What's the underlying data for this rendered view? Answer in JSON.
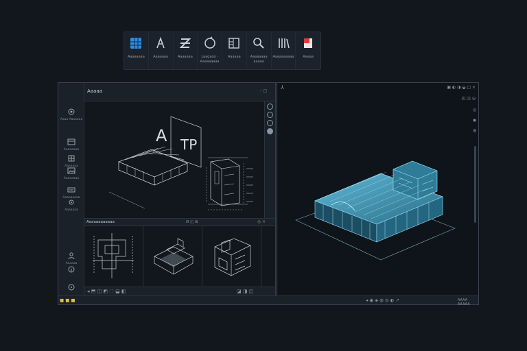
{
  "ribbon": {
    "buttons": [
      {
        "icon": "grid-icon",
        "label": "Aaaaaaaa",
        "color": "#2d8de0"
      },
      {
        "icon": "compass-icon",
        "label": "Aaaaaaa"
      },
      {
        "icon": "section-icon",
        "label": "Aaaaaaa"
      },
      {
        "icon": "rotate-icon",
        "label": "Laagaoo · Aaaaaaaaa"
      },
      {
        "icon": "panel-icon",
        "label": "Aaaaaa"
      },
      {
        "icon": "search-icon",
        "label": "Aaaaaaaa aaaaa"
      },
      {
        "icon": "library-icon",
        "label": "Aaaaaaaaaa"
      },
      {
        "icon": "flag-icon",
        "label": "Aaaaa",
        "color": "#e03b3b"
      }
    ]
  },
  "window": {
    "left_title": "Aaaaa",
    "left_controls": "– □",
    "subpanel_title": "Aaaaaaaaaaaa",
    "subpanel_controls": "Ø ◱ ⊞",
    "subpanel_right": "◎ ×",
    "viewport_text_a": "A",
    "viewport_text_b": "TP",
    "lefttool": [
      {
        "icon": "move-icon",
        "label": "Aaaa Aaaaaaa"
      },
      {
        "icon": "layer-icon",
        "label": "Aaaaaaaa"
      },
      {
        "icon": "grid-small-icon",
        "label": "Aaaaaaa"
      },
      {
        "icon": "image-icon",
        "label": "Aaaaaaaa"
      },
      {
        "icon": "link-icon",
        "label": "Aaaaaaaaa"
      },
      {
        "icon": "settings-icon",
        "label": "Aaaaaaa"
      },
      {
        "icon": "user-icon",
        "label": "Aaaaaa"
      }
    ],
    "right_title_glyph": "⅄",
    "right_controls": "▣ ◐ ◑ ◒ □ ×",
    "right_controls2": "◰ ◳ ◶",
    "right_side": "◎ ◉ ◍"
  },
  "statusbar": {
    "left_icons": "■ ■ ■",
    "left_tools": "◂ ⬒ ◫ ◩ ⬚ ⬓ ◧",
    "mid_tools": "◪ ◨ ◫",
    "right_tools": "◂ ◉ ◈ ◍ ◎ ◐ ↗",
    "right_text": "AAAA · AAAAA"
  }
}
